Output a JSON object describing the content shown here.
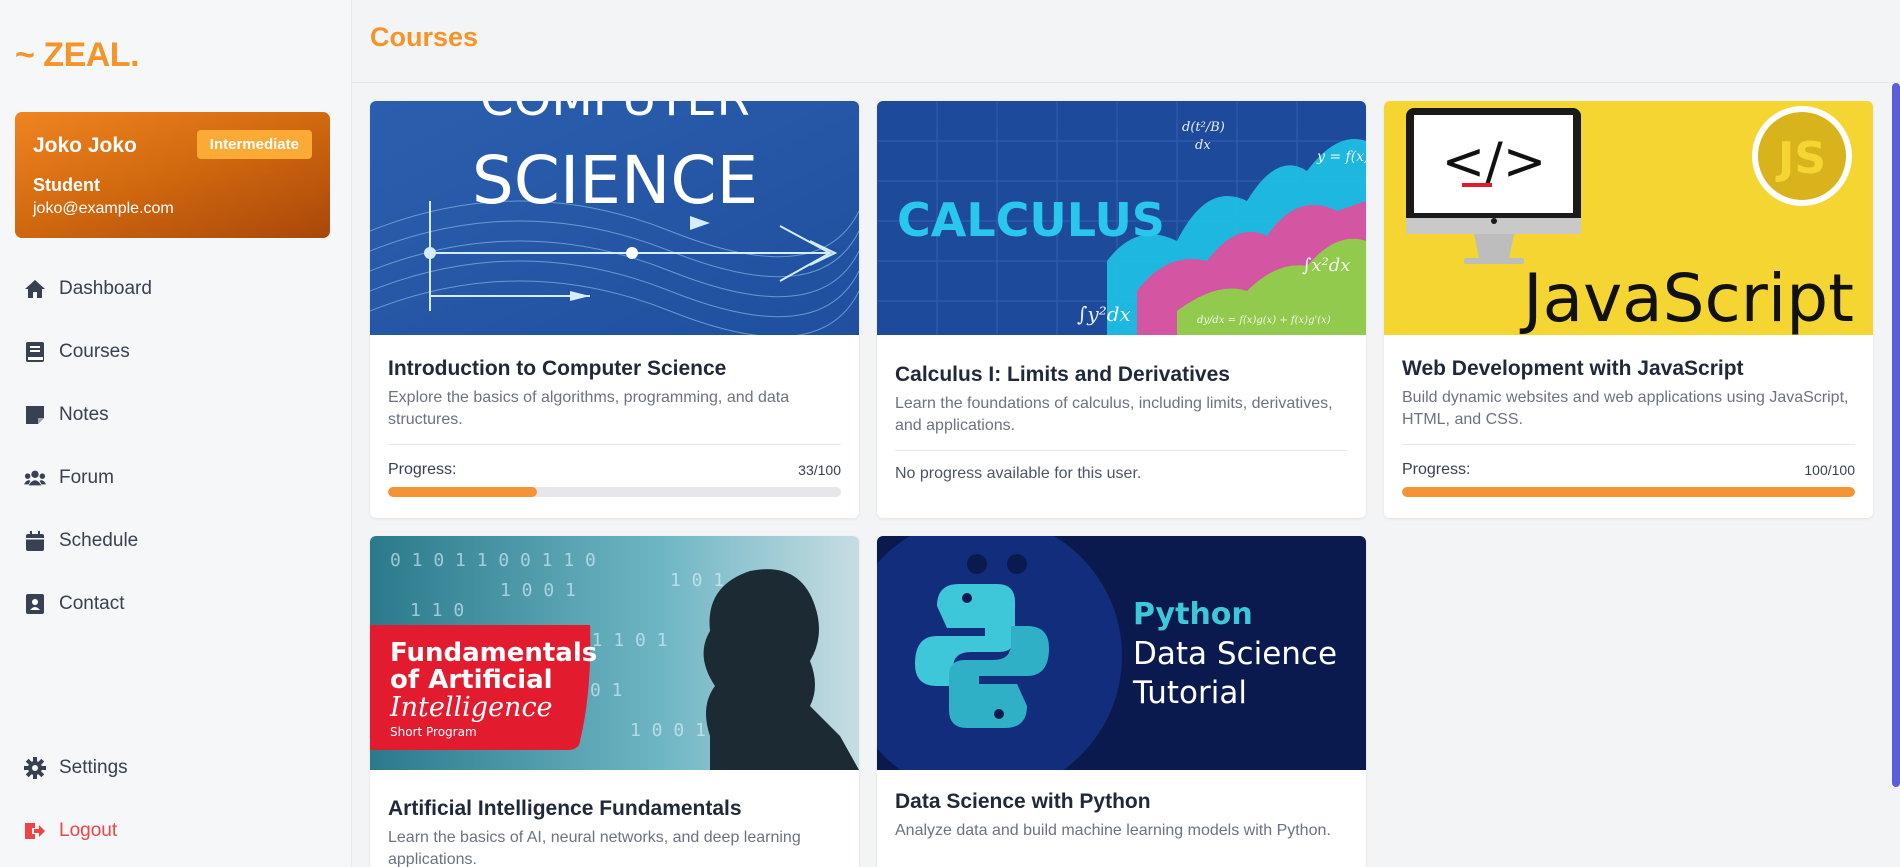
{
  "app": {
    "logo": "~ ZEAL."
  },
  "profile": {
    "name": "Joko Joko",
    "level": "Intermediate",
    "role": "Student",
    "email": "joko@example.com"
  },
  "nav": {
    "items": [
      {
        "label": "Dashboard",
        "icon": "home-icon"
      },
      {
        "label": "Courses",
        "icon": "book-icon"
      },
      {
        "label": "Notes",
        "icon": "note-icon"
      },
      {
        "label": "Forum",
        "icon": "users-icon"
      },
      {
        "label": "Schedule",
        "icon": "calendar-icon"
      },
      {
        "label": "Contact",
        "icon": "contact-book-icon"
      }
    ],
    "settings": "Settings",
    "logout": "Logout"
  },
  "page": {
    "title": "Courses"
  },
  "courses": [
    {
      "title": "Introduction to Computer Science",
      "description": "Explore the basics of algorithms, programming, and data structures.",
      "progress_label": "Progress:",
      "progress_text": "33/100",
      "progress": 0.33,
      "thumb_text": [
        "COMPUTER",
        "SCIENCE"
      ]
    },
    {
      "title": "Calculus I: Limits and Derivatives",
      "description": "Learn the foundations of calculus, including limits, derivatives, and applications.",
      "no_progress": "No progress available for this user.",
      "thumb_text": [
        "CALCULUS"
      ]
    },
    {
      "title": "Web Development with JavaScript",
      "description": "Build dynamic websites and web applications using JavaScript, HTML, and CSS.",
      "progress_label": "Progress:",
      "progress_text": "100/100",
      "progress": 1.0,
      "thumb_text": [
        "JavaScript",
        "JS",
        "</>"
      ]
    },
    {
      "title": "Artificial Intelligence Fundamentals",
      "description": "Learn the basics of AI, neural networks, and deep learning applications.",
      "thumb_text": [
        "Fundamentals",
        "of Artificial",
        "Intelligence",
        "Short Program"
      ]
    },
    {
      "title": "Data Science with Python",
      "description": "Analyze data and build machine learning models with Python.",
      "thumb_text": [
        "Python",
        "Data Science",
        "Tutorial"
      ]
    }
  ],
  "colors": {
    "accent": "#f59428",
    "logout": "#ef4444",
    "scrollbar": "#5a5fd8"
  }
}
